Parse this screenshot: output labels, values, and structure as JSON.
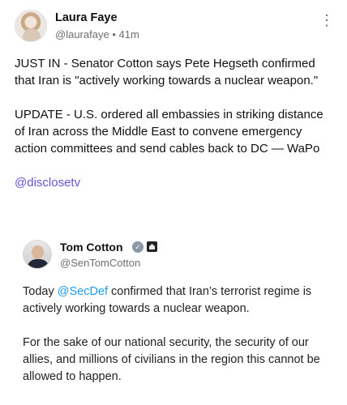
{
  "post": {
    "author_name": "Laura Faye",
    "handle": "@laurafaye",
    "separator": "•",
    "time": "41m",
    "paragraph_1": "JUST IN - Senator Cotton says Pete Hegseth confirmed that Iran is \"actively working towards a nuclear weapon.\"",
    "paragraph_2": "UPDATE - U.S. ordered all embassies in striking distance of Iran across the Middle East to convene emergency action committees and send cables back to DC — WaPo",
    "mention": "@disclosetv",
    "more_icon": "more-vertical-icon"
  },
  "quote": {
    "author_name": "Tom Cotton",
    "handle": "@SenTomCotton",
    "verified_icon": "verified-badge-icon",
    "affiliation_icon": "government-building-icon",
    "line_prefix": "Today ",
    "mention": "@SecDef",
    "line_rest": " confirmed that Iran’s terrorist regime is actively working towards a nuclear weapon.",
    "paragraph_2": "For the sake of our national security, the security of our allies, and millions of civilians in the region this cannot be allowed to happen."
  },
  "colors": {
    "mention_purple": "#6b52d8",
    "quote_mention_blue": "#1d9bf0",
    "meta_gray": "#6f6f6f"
  }
}
